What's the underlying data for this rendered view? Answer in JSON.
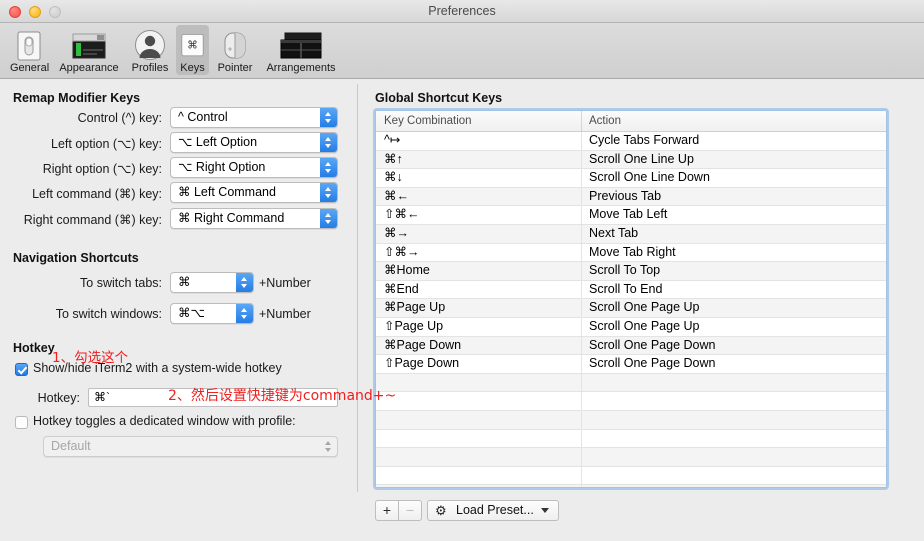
{
  "window": {
    "title": "Preferences",
    "traffic_lights": [
      "close",
      "minimize",
      "zoom"
    ]
  },
  "toolbar": {
    "items": [
      {
        "label": "General",
        "icon": "general-icon",
        "selected": false
      },
      {
        "label": "Appearance",
        "icon": "appearance-icon",
        "selected": false
      },
      {
        "label": "Profiles",
        "icon": "profiles-icon",
        "selected": false
      },
      {
        "label": "Keys",
        "icon": "keys-icon",
        "selected": true
      },
      {
        "label": "Pointer",
        "icon": "pointer-icon",
        "selected": false
      },
      {
        "label": "Arrangements",
        "icon": "arrangements-icon",
        "selected": false
      }
    ]
  },
  "remap_section": {
    "heading": "Remap Modifier Keys",
    "rows": [
      {
        "label": "Control (^) key:",
        "value": "^ Control"
      },
      {
        "label": "Left option (⌥) key:",
        "value": "⌥ Left Option"
      },
      {
        "label": "Right option (⌥) key:",
        "value": "⌥ Right Option"
      },
      {
        "label": "Left command (⌘) key:",
        "value": "⌘ Left Command"
      },
      {
        "label": "Right command (⌘) key:",
        "value": "⌘ Right Command"
      }
    ]
  },
  "navigation_section": {
    "heading": "Navigation Shortcuts",
    "rows": [
      {
        "label": "To switch tabs:",
        "value": "⌘",
        "suffix": "+Number"
      },
      {
        "label": "To switch windows:",
        "value": "⌘⌥",
        "suffix": "+Number"
      }
    ]
  },
  "hotkey_section": {
    "heading": "Hotkey",
    "show_hide_checkbox": {
      "label": "Show/hide iTerm2 with a system-wide hotkey",
      "checked": true
    },
    "hotkey_label": "Hotkey:",
    "hotkey_value": "⌘`",
    "dedicated_checkbox": {
      "label": "Hotkey toggles a dedicated window with profile:",
      "checked": false
    },
    "profile_value": "Default",
    "profile_disabled": true
  },
  "global_section": {
    "heading": "Global Shortcut Keys",
    "columns": [
      "Key Combination",
      "Action"
    ],
    "rows": [
      {
        "key": "^↦",
        "action": "Cycle Tabs Forward"
      },
      {
        "key": "⌘↑",
        "action": "Scroll One Line Up"
      },
      {
        "key": "⌘↓",
        "action": "Scroll One Line Down"
      },
      {
        "key": "⌘←",
        "action": "Previous Tab"
      },
      {
        "key": "⇧⌘←",
        "action": "Move Tab Left"
      },
      {
        "key": "⌘→",
        "action": "Next Tab"
      },
      {
        "key": "⇧⌘→",
        "action": "Move Tab Right"
      },
      {
        "key": "⌘Home",
        "action": "Scroll To Top"
      },
      {
        "key": "⌘End",
        "action": "Scroll To End"
      },
      {
        "key": "⌘Page Up",
        "action": "Scroll One Page Up"
      },
      {
        "key": "⇧Page Up",
        "action": "Scroll One Page Up"
      },
      {
        "key": "⌘Page Down",
        "action": "Scroll One Page Down"
      },
      {
        "key": "⇧Page Down",
        "action": "Scroll One Page Down"
      },
      {
        "key": "",
        "action": ""
      },
      {
        "key": "",
        "action": ""
      },
      {
        "key": "",
        "action": ""
      },
      {
        "key": "",
        "action": ""
      },
      {
        "key": "",
        "action": ""
      },
      {
        "key": "",
        "action": ""
      },
      {
        "key": "",
        "action": ""
      }
    ]
  },
  "bottom_bar": {
    "add_label": "+",
    "remove_label": "−",
    "preset_label": "Load Preset...",
    "preset_icon": "gear-icon"
  },
  "annotations": [
    {
      "text": "1、勾选这个",
      "color": "#ef2020"
    },
    {
      "text": "2、然后设置快捷键为command+~",
      "color": "#ef2020"
    }
  ]
}
